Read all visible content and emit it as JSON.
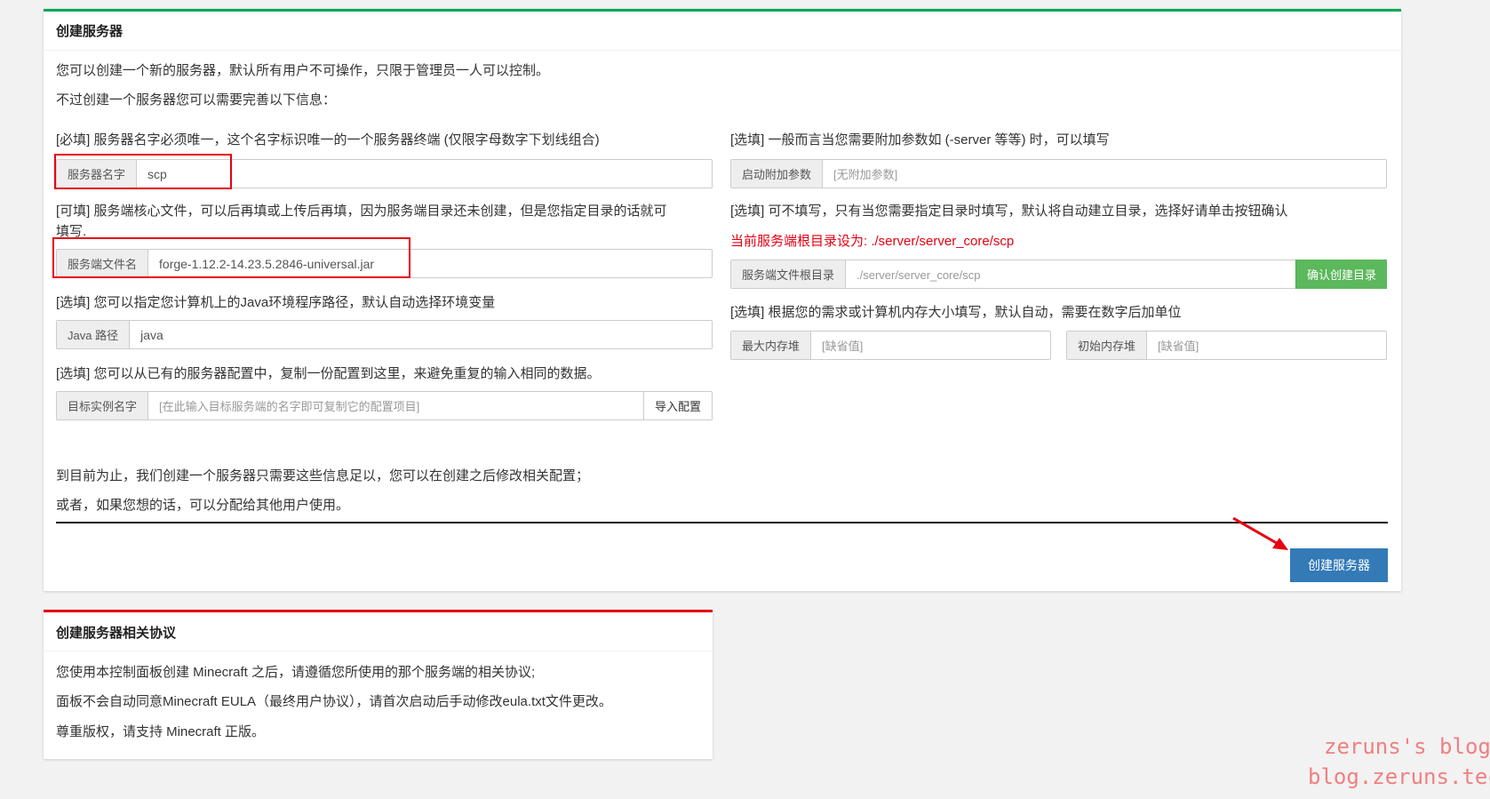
{
  "create_panel": {
    "title": "创建服务器",
    "intro1": "您可以创建一个新的服务器，默认所有用户不可操作，只限于管理员一人可以控制。",
    "intro2": "不过创建一个服务器您可以需要完善以下信息：",
    "name_hint": "[必填] 服务器名字必须唯一，这个名字标识唯一的一个服务器终端 (仅限字母数字下划线组合)",
    "name_label": "服务器名字",
    "name_value": "scp",
    "jar_hint1": "[可填] 服务端核心文件，可以后再填或上传后再填，因为服务端目录还未创建，但是您指定目录的话就可",
    "jar_hint2": "填写.",
    "jar_label": "服务端文件名",
    "jar_value": "forge-1.12.2-14.23.5.2846-universal.jar",
    "java_hint": "[选填] 您可以指定您计算机上的Java环境程序路径，默认自动选择环境变量",
    "java_label": "Java 路径",
    "java_value": "java",
    "copy_hint": "[选填] 您可以从已有的服务器配置中，复制一份配置到这里，来避免重复的输入相同的数据。",
    "copy_label": "目标实例名字",
    "copy_placeholder": "[在此输入目标服务端的名字即可复制它的配置项目]",
    "copy_button": "导入配置",
    "args_hint": "[选填] 一般而言当您需要附加参数如 (-server 等等) 时，可以填写",
    "args_label": "启动附加参数",
    "args_placeholder": "[无附加参数]",
    "dir_hint": "[选填] 可不填写，只有当您需要指定目录时填写，默认将自动建立目录，选择好请单击按钮确认",
    "dir_current": "当前服务端根目录设为: ./server/server_core/scp",
    "dir_label": "服务端文件根目录",
    "dir_placeholder": "./server/server_core/scp",
    "dir_button": "确认创建目录",
    "mem_hint": "[选填] 根据您的需求或计算机内存大小填写，默认自动，需要在数字后加单位",
    "max_label": "最大内存堆",
    "max_placeholder": "[缺省值]",
    "min_label": "初始内存堆",
    "min_placeholder": "[缺省值]",
    "footer1": "到目前为止，我们创建一个服务器只需要这些信息足以，您可以在创建之后修改相关配置；",
    "footer2": "或者，如果您想的话，可以分配给其他用户使用。",
    "create_button": "创建服务器"
  },
  "license_panel": {
    "title": "创建服务器相关协议",
    "line1": "您使用本控制面板创建 Minecraft 之后，请遵循您所使用的那个服务端的相关协议;",
    "line2": "面板不会自动同意Minecraft EULA（最终用户协议），请首次启动后手动修改eula.txt文件更改。",
    "line3": "尊重版权，请支持 Minecraft 正版。"
  },
  "watermark": {
    "line1": "zeruns's blog",
    "line2": "blog.zeruns.tech"
  },
  "colors": {
    "green": "#00a65a",
    "red": "#e60012",
    "blue": "#337ab7",
    "success": "#5cb85c"
  }
}
